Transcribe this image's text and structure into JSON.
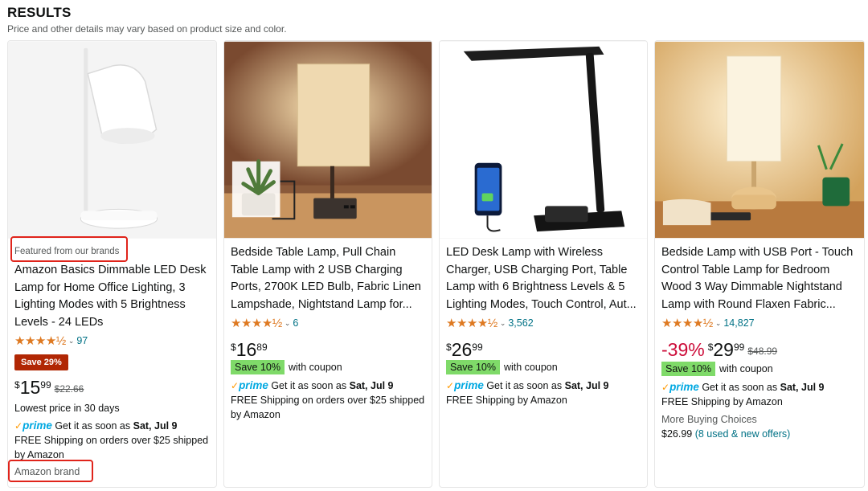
{
  "header": {
    "title": "RESULTS",
    "subtitle": "Price and other details may vary based on product size and color."
  },
  "colors": {
    "star": "#de7921",
    "link": "#007185",
    "save_badge": "#b12704",
    "coupon_badge": "#7fda69",
    "discount": "#cc0c39",
    "callout": "#e0241b",
    "prime": "#00a8e1"
  },
  "products": [
    {
      "featured_label": "Featured from our brands",
      "title": "Amazon Basics Dimmable LED Desk Lamp for Home Office Lighting, 3 Lighting Modes with 5 Brightness Levels - 24 LEDs",
      "stars": "★★★★½",
      "rating": 4.5,
      "review_count": "97",
      "save_badge": "Save 29%",
      "price_symbol": "$",
      "price_whole": "15",
      "price_fraction": "99",
      "list_price": "$22.66",
      "lowest_price_note": "Lowest price in 30 days",
      "prime_check": "✓",
      "prime_label": "prime",
      "delivery_prefix": "Get it as soon as",
      "delivery_date": "Sat, Jul 9",
      "shipping": "FREE Shipping on orders over $25 shipped by Amazon",
      "brand_label": "Amazon brand",
      "image_icon": "white-desk-lamp-image"
    },
    {
      "title": "Bedside Table Lamp, Pull Chain Table Lamp with 2 USB Charging Ports, 2700K LED Bulb, Fabric Linen Lampshade, Nightstand Lamp for...",
      "stars": "★★★★½",
      "rating": 4.5,
      "review_count": "6",
      "price_symbol": "$",
      "price_whole": "16",
      "price_fraction": "89",
      "coupon_badge": "Save 10%",
      "coupon_text": "with coupon",
      "prime_check": "✓",
      "prime_label": "prime",
      "delivery_prefix": "Get it as soon as",
      "delivery_date": "Sat, Jul 9",
      "shipping": "FREE Shipping on orders over $25 shipped by Amazon",
      "image_icon": "linen-table-lamp-image"
    },
    {
      "title": "LED Desk Lamp with Wireless Charger, USB Charging Port, Table Lamp with 6 Brightness Levels & 5 Lighting Modes, Touch Control, Aut...",
      "stars": "★★★★½",
      "rating": 4.5,
      "review_count": "3,562",
      "price_symbol": "$",
      "price_whole": "26",
      "price_fraction": "99",
      "coupon_badge": "Save 10%",
      "coupon_text": "with coupon",
      "prime_check": "✓",
      "prime_label": "prime",
      "delivery_prefix": "Get it as soon as",
      "delivery_date": "Sat, Jul 9",
      "shipping": "FREE Shipping by Amazon",
      "image_icon": "black-desk-lamp-wireless-charger-image"
    },
    {
      "title": "Bedside Lamp with USB Port - Touch Control Table Lamp for Bedroom Wood 3 Way Dimmable Nightstand Lamp with Round Flaxen Fabric...",
      "stars": "★★★★½",
      "rating": 4.5,
      "review_count": "14,827",
      "discount": "-39%",
      "price_symbol": "$",
      "price_whole": "29",
      "price_fraction": "99",
      "list_price": "$48.99",
      "coupon_badge": "Save 10%",
      "coupon_text": "with coupon",
      "prime_check": "✓",
      "prime_label": "prime",
      "delivery_prefix": "Get it as soon as",
      "delivery_date": "Sat, Jul 9",
      "shipping": "FREE Shipping by Amazon",
      "more_buying": "More Buying Choices",
      "offer_price": "$26.99",
      "offer_link": "(8 used & new offers)",
      "image_icon": "wood-bedside-lamp-image"
    }
  ]
}
